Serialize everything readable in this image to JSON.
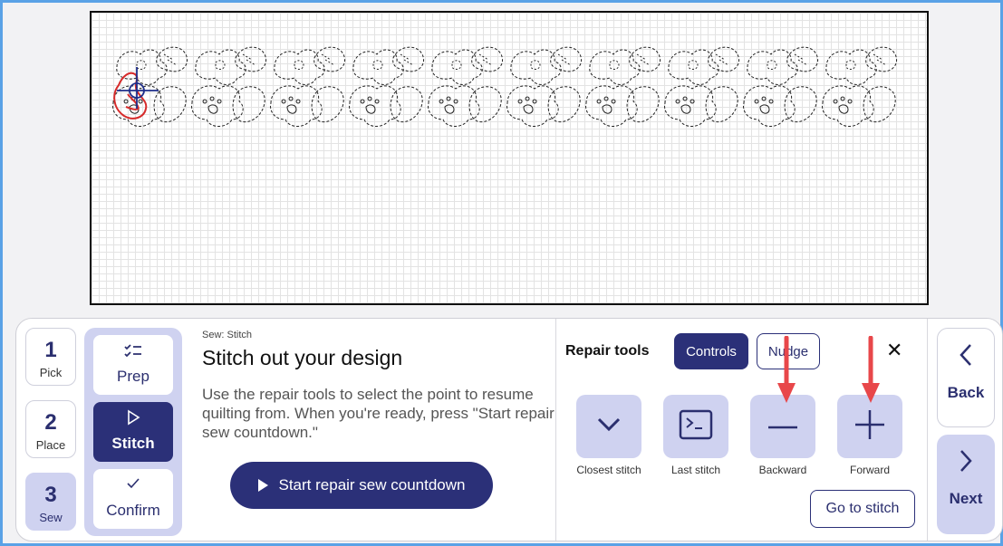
{
  "steps": [
    {
      "num": "1",
      "label": "Pick"
    },
    {
      "num": "2",
      "label": "Place"
    },
    {
      "num": "3",
      "label": "Sew"
    }
  ],
  "substeps": [
    {
      "icon": "checklist-icon",
      "label": "Prep"
    },
    {
      "icon": "play-outline-icon",
      "label": "Stitch"
    },
    {
      "icon": "check-icon",
      "label": "Confirm"
    }
  ],
  "description": {
    "kicker": "Sew: Stitch",
    "title": "Stitch out your design",
    "body": "Use the repair tools to select the point to resume quilting from. When you're ready, press \"Start repair sew countdown.\"",
    "start_button": "Start repair sew countdown"
  },
  "repair": {
    "title": "Repair tools",
    "tab_controls": "Controls",
    "tab_nudge": "Nudge",
    "tools": [
      {
        "icon": "chevron-down-icon",
        "label": "Closest stitch"
      },
      {
        "icon": "terminal-icon",
        "label": "Last stitch"
      },
      {
        "icon": "minus-icon",
        "label": "Backward"
      },
      {
        "icon": "plus-icon",
        "label": "Forward"
      }
    ],
    "go_to_stitch": "Go to stitch"
  },
  "nav": {
    "back": "Back",
    "next": "Next"
  },
  "colors": {
    "primary": "#2b3078",
    "accent_light": "#cfd2f0",
    "annotation": "#e8474a",
    "needle": "#d62b2b"
  }
}
